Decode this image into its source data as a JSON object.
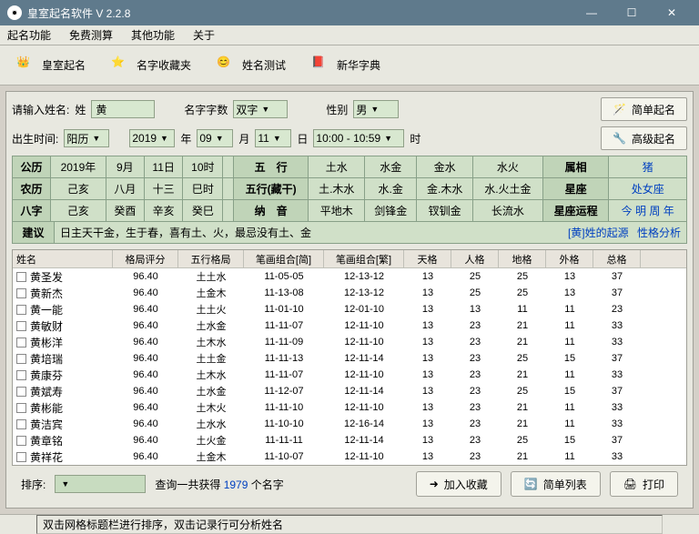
{
  "window": {
    "title": "皇室起名软件 V 2.2.8"
  },
  "menu": [
    "起名功能",
    "免费测算",
    "其他功能",
    "关于"
  ],
  "toolbar": [
    {
      "label": "皇室起名"
    },
    {
      "label": "名字收藏夹"
    },
    {
      "label": "姓名测试"
    },
    {
      "label": "新华字典"
    }
  ],
  "form": {
    "label_surname": "请输入姓名:",
    "label_xing": "姓",
    "surname": "黄",
    "label_chars": "名字字数",
    "chars": "双字",
    "label_sex": "性别",
    "sex": "男",
    "btn_simple": "简单起名",
    "label_birth": "出生时间:",
    "cal": "阳历",
    "year": "2019",
    "year_u": "年",
    "month": "09",
    "month_u": "月",
    "day": "11",
    "day_u": "日",
    "time": "10:00 - 10:59",
    "time_u": "时",
    "btn_adv": "高级起名"
  },
  "info": {
    "row1": [
      "公历",
      "2019年",
      "9月",
      "11日",
      "10时",
      "",
      "五　行",
      "土水",
      "水金",
      "金水",
      "水火",
      "属相",
      "猪"
    ],
    "row2": [
      "农历",
      "己亥",
      "八月",
      "十三",
      "巳时",
      "",
      "五行(藏干)",
      "土.木水",
      "水.金",
      "金.木水",
      "水.火土金",
      "星座",
      "处女座"
    ],
    "row3": [
      "八字",
      "己亥",
      "癸酉",
      "辛亥",
      "癸巳",
      "",
      "纳　音",
      "平地木",
      "剑锋金",
      "钗钏金",
      "长流水",
      "星座运程",
      "今 明 周 年"
    ],
    "suggest_h": "建议",
    "suggest_t": "日主天干金，生于春，喜有土、火，最忌没有土、金",
    "link1": "[黄]姓的起源",
    "link2": "性格分析"
  },
  "thead": [
    "姓名",
    "格局评分",
    "五行格局",
    "笔画组合[简]",
    "笔画组合[繁]",
    "天格",
    "人格",
    "地格",
    "外格",
    "总格"
  ],
  "rows": [
    [
      "黄圣发",
      "96.40",
      "土土水",
      "11-05-05",
      "12-13-12",
      "13",
      "25",
      "25",
      "13",
      "37"
    ],
    [
      "黄新杰",
      "96.40",
      "土金木",
      "11-13-08",
      "12-13-12",
      "13",
      "25",
      "25",
      "13",
      "37"
    ],
    [
      "黄一能",
      "96.40",
      "土土火",
      "11-01-10",
      "12-01-10",
      "13",
      "13",
      "11",
      "11",
      "23"
    ],
    [
      "黄敏财",
      "96.40",
      "土水金",
      "11-11-07",
      "12-11-10",
      "13",
      "23",
      "21",
      "11",
      "33"
    ],
    [
      "黄彬洋",
      "96.40",
      "土木水",
      "11-11-09",
      "12-11-10",
      "13",
      "23",
      "21",
      "11",
      "33"
    ],
    [
      "黄培瑞",
      "96.40",
      "土土金",
      "11-11-13",
      "12-11-14",
      "13",
      "23",
      "25",
      "15",
      "37"
    ],
    [
      "黄康芬",
      "96.40",
      "土木水",
      "11-11-07",
      "12-11-10",
      "13",
      "23",
      "21",
      "11",
      "33"
    ],
    [
      "黄斌寿",
      "96.40",
      "土水金",
      "11-12-07",
      "12-11-14",
      "13",
      "23",
      "25",
      "15",
      "37"
    ],
    [
      "黄彬能",
      "96.40",
      "土木火",
      "11-11-10",
      "12-11-10",
      "13",
      "23",
      "21",
      "11",
      "33"
    ],
    [
      "黄洁宾",
      "96.40",
      "土水水",
      "11-10-10",
      "12-16-14",
      "13",
      "23",
      "21",
      "11",
      "33"
    ],
    [
      "黄章铭",
      "96.40",
      "土火金",
      "11-11-11",
      "12-11-14",
      "13",
      "23",
      "25",
      "15",
      "37"
    ],
    [
      "黄祥花",
      "96.40",
      "土金木",
      "11-10-07",
      "12-11-10",
      "13",
      "23",
      "21",
      "11",
      "33"
    ]
  ],
  "bottom": {
    "sort_label": "排序:",
    "result_prefix": "查询一共获得 ",
    "result_count": "1979",
    "result_suffix": " 个名字",
    "btn_fav": "加入收藏",
    "btn_list": "简单列表",
    "btn_print": "打印"
  },
  "status": "双击网格标题栏进行排序，双击记录行可分析姓名"
}
